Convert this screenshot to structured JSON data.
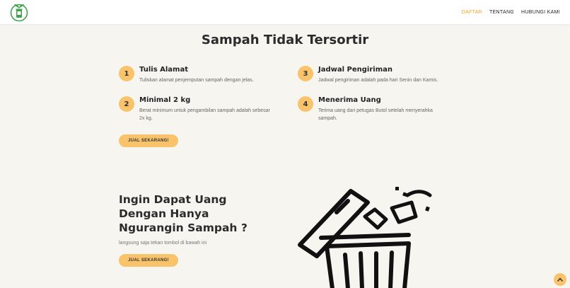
{
  "nav": {
    "logo_icon": "recycle-bin-leaf-icon",
    "links": [
      {
        "label": "DAFTAR",
        "active": true
      },
      {
        "label": "TENTANG",
        "active": false
      },
      {
        "label": "HUBUNGI KAMI",
        "active": false
      }
    ],
    "active_color": "#f5a623"
  },
  "main": {
    "title": "Sampah Tidak Tersortir",
    "steps": [
      {
        "number": "1",
        "title": "Tulis Alamat",
        "desc": "Tuliskan alamat penjemputan sampah dengan jelas."
      },
      {
        "number": "2",
        "title": "Minimal 2 kg",
        "desc": "Berat minimum untuk pengambilan sampah adalah sebesar 2x kg."
      },
      {
        "number": "3",
        "title": "Jadwal Pengiriman",
        "desc": "Jadwal pengiriman adalah pada hari Senin dan Kamis."
      },
      {
        "number": "4",
        "title": "Menerima Uang",
        "desc": "Terima uang dari petugas Butol setelah menyerahka sampah."
      }
    ],
    "cta_label": "JUAL SEKARANG!"
  },
  "promo": {
    "title_line1": "Ingin Dapat Uang",
    "title_line2": "Dengan Hanya",
    "title_line3": "Ngurangin Sampah ?",
    "subtitle": "langsung saja tekan tombol di bawah ini",
    "cta_label": "JUAL SEKARANG!",
    "illustration_icon": "trash-can-icon"
  },
  "scroll_top_icon": "chevron-up-icon",
  "accent_color": "#f9c36b"
}
